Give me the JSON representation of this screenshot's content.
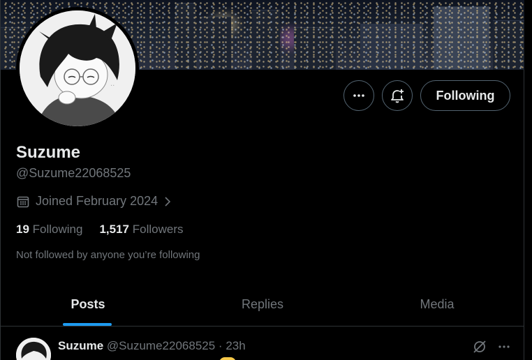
{
  "profile": {
    "name": "Suzume",
    "handle": "@Suzume22068525",
    "joined": "Joined February 2024",
    "following_count": "19",
    "following_label": "Following",
    "followers_count": "1,517",
    "followers_label": "Followers",
    "not_followed_text": "Not followed by anyone you’re following"
  },
  "actions": {
    "more_icon": "more-dots-icon",
    "notify_icon": "bell-plus-icon",
    "follow_button_label": "Following"
  },
  "tabs": [
    {
      "label": "Posts",
      "active": true
    },
    {
      "label": "Replies",
      "active": false
    },
    {
      "label": "Media",
      "active": false
    }
  ],
  "post": {
    "author_name": "Suzume",
    "author_handle": "@Suzume22068525",
    "separator": "·",
    "time": "23h"
  },
  "colors": {
    "background": "#000000",
    "text_primary": "#e7e9ea",
    "text_secondary": "#71767b",
    "border": "#2f3336",
    "accent": "#1d9bf0"
  }
}
